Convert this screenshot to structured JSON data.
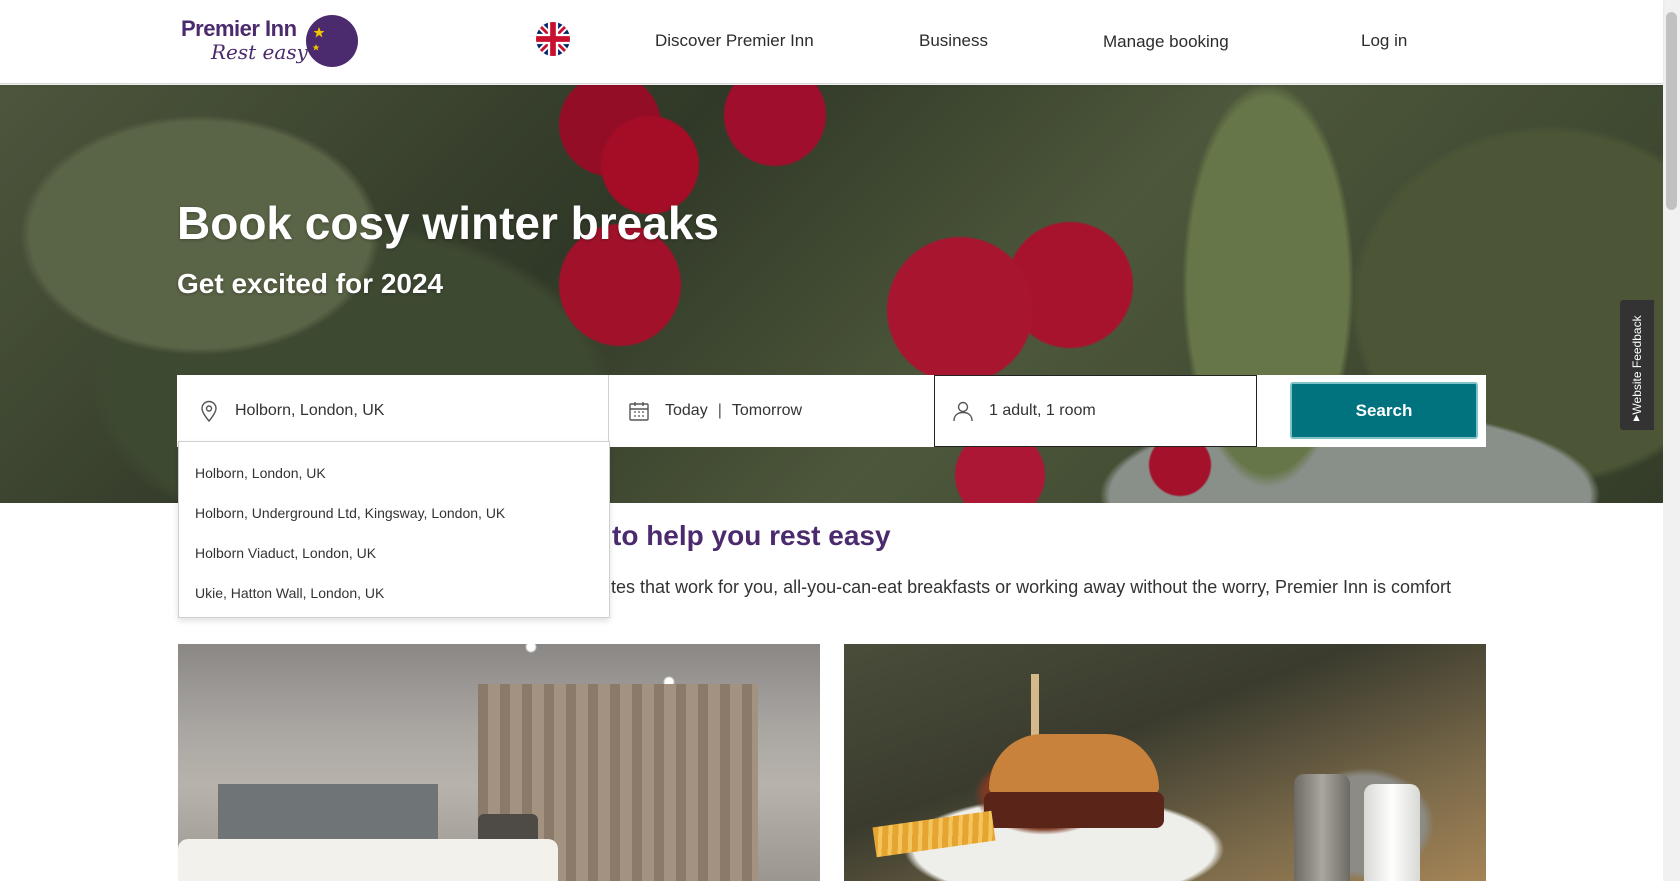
{
  "header": {
    "logo": {
      "brand": "Premier Inn",
      "tagline": "Rest easy"
    },
    "nav": {
      "discover": "Discover Premier Inn",
      "business": "Business",
      "manage_booking": "Manage booking",
      "login": "Log in"
    },
    "language_icon": "uk-flag-icon"
  },
  "hero": {
    "title": "Book cosy winter breaks",
    "subtitle": "Get excited for 2024"
  },
  "search": {
    "location_value": "Holborn, London, UK",
    "location_icon": "location-pin-icon",
    "dates": {
      "checkin": "Today",
      "separator": "|",
      "checkout": "Tomorrow"
    },
    "calendar_icon": "calendar-icon",
    "guests_value": "1 adult, 1 room",
    "guests_icon": "person-icon",
    "button_label": "Search",
    "button_color": "#00737f"
  },
  "suggestions": [
    "Holborn, London, UK",
    "Holborn, Underground Ltd, Kingsway, London, UK",
    "Holborn Viaduct, London, UK",
    "Ukie, Hatton Wall, London, UK"
  ],
  "intro": {
    "heading_visible": "to help you rest easy",
    "text_visible": "tes that work for you, all-you-can-eat breakfasts or working away without the worry, Premier Inn is comfort"
  },
  "feedback": {
    "label": "Website Feedback"
  },
  "colors": {
    "brand_purple": "#4b2a6e",
    "search_teal": "#00737f"
  }
}
